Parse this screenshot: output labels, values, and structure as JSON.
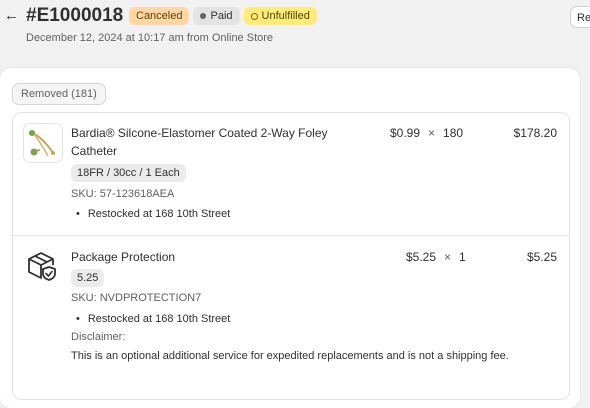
{
  "header": {
    "back_glyph": "←",
    "order_number": "#E1000018",
    "badges": {
      "canceled": "Canceled",
      "paid": "Paid",
      "unfulfilled": "Unfulfilled"
    },
    "subtitle": "December 12, 2024 at 10:17 am from Online Store",
    "right_button_label": "Re"
  },
  "section": {
    "removed_label": "Removed (181)"
  },
  "items": [
    {
      "title": "Bardia® Silcone-Elastomer Coated 2-Way Foley Catheter",
      "unit_price": "$0.99",
      "times": "×",
      "quantity": "180",
      "total": "$178.20",
      "variant": "18FR / 30cc / 1 Each",
      "sku": "SKU: 57-123618AEA",
      "restock": "Restocked at 168 10th Street",
      "thumbnail_icon": "catheter-product-image"
    },
    {
      "title": "Package Protection",
      "unit_price": "$5.25",
      "times": "×",
      "quantity": "1",
      "total": "$5.25",
      "variant": "5.25",
      "sku": "SKU: NVDPROTECTION7",
      "restock": "Restocked at 168 10th Street",
      "disclaimer_label": "Disclaimer:",
      "disclaimer_text": "This is an optional additional service for expedited replacements and is not a shipping fee.",
      "thumbnail_icon": "package-shield-icon"
    }
  ],
  "colors": {
    "canceled_badge": "#ffd6a4",
    "paid_badge": "#e3e3e3",
    "unfulfilled_badge": "#ffeb78",
    "page_background": "#f1f1f1"
  }
}
